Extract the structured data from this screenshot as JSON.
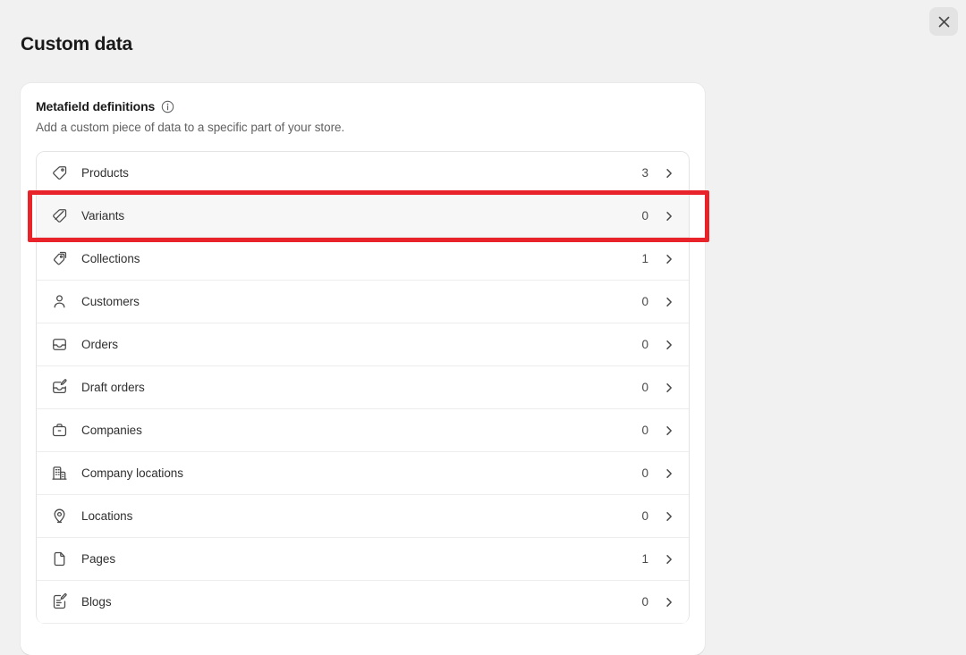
{
  "page": {
    "title": "Custom data",
    "background_color": "#f1f1f1"
  },
  "close_button": {
    "name": "close",
    "icon": "close-icon"
  },
  "card": {
    "title": "Metafield definitions",
    "info_icon": "info-circle-icon",
    "subtitle": "Add a custom piece of data to a specific part of your store.",
    "rows": [
      {
        "label": "Products",
        "count": "3",
        "icon": "tag-icon",
        "selected": false
      },
      {
        "label": "Variants",
        "count": "0",
        "icon": "tag-slash-icon",
        "selected": true
      },
      {
        "label": "Collections",
        "count": "1",
        "icon": "tag-stack-icon",
        "selected": false
      },
      {
        "label": "Customers",
        "count": "0",
        "icon": "person-icon",
        "selected": false
      },
      {
        "label": "Orders",
        "count": "0",
        "icon": "inbox-icon",
        "selected": false
      },
      {
        "label": "Draft orders",
        "count": "0",
        "icon": "inbox-edit-icon",
        "selected": false
      },
      {
        "label": "Companies",
        "count": "0",
        "icon": "briefcase-icon",
        "selected": false
      },
      {
        "label": "Company locations",
        "count": "0",
        "icon": "building-icon",
        "selected": false
      },
      {
        "label": "Locations",
        "count": "0",
        "icon": "map-pin-icon",
        "selected": false
      },
      {
        "label": "Pages",
        "count": "1",
        "icon": "page-icon",
        "selected": false
      },
      {
        "label": "Blogs",
        "count": "0",
        "icon": "note-edit-icon",
        "selected": false
      }
    ]
  },
  "annotation": {
    "highlight_target": "Variants",
    "color": "#e8242a"
  }
}
